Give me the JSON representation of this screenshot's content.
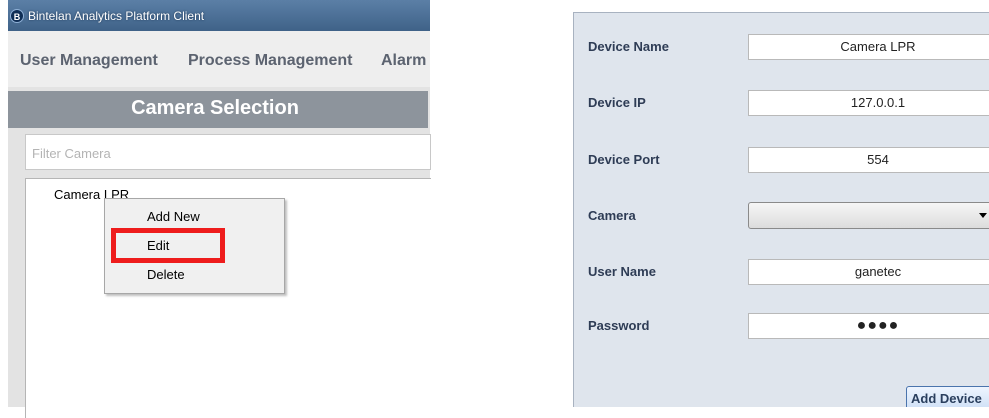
{
  "window": {
    "title": "Bintelan Analytics Platform Client"
  },
  "menu": [
    "User Management",
    "Process Management",
    "Alarm"
  ],
  "camera_selection": {
    "header": "Camera Selection",
    "filter_placeholder": "Filter Camera",
    "tree_item": "Camera LPR"
  },
  "context_menu": {
    "items": [
      "Add New",
      "Edit",
      "Delete"
    ],
    "highlighted": "Edit"
  },
  "device_form": {
    "fields": [
      {
        "label": "Device Name",
        "value": "Camera LPR"
      },
      {
        "label": "Device IP",
        "value": "127.0.0.1"
      },
      {
        "label": "Device Port",
        "value": "554"
      },
      {
        "label": "Camera",
        "value": ""
      },
      {
        "label": "User Name",
        "value": "ganetec"
      },
      {
        "label": "Password",
        "value": "●●●●"
      }
    ],
    "add_button": "Add Device"
  },
  "colors": {
    "highlight_border": "#ee1c1c",
    "header_bg": "#8d949c",
    "form_bg": "#dfe5ed"
  }
}
